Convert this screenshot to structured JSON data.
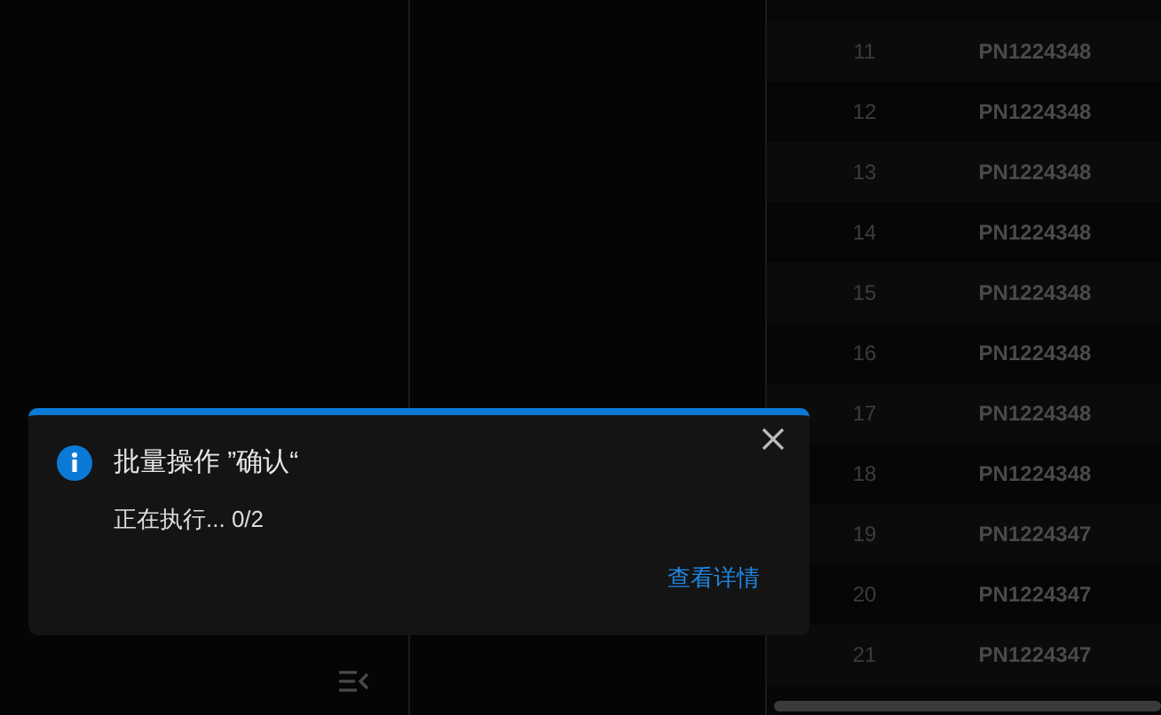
{
  "table": {
    "rows": [
      {
        "index": "11",
        "part_no": "PN1224348"
      },
      {
        "index": "12",
        "part_no": "PN1224348"
      },
      {
        "index": "13",
        "part_no": "PN1224348"
      },
      {
        "index": "14",
        "part_no": "PN1224348"
      },
      {
        "index": "15",
        "part_no": "PN1224348"
      },
      {
        "index": "16",
        "part_no": "PN1224348"
      },
      {
        "index": "17",
        "part_no": "PN1224348"
      },
      {
        "index": "18",
        "part_no": "PN1224348"
      },
      {
        "index": "19",
        "part_no": "PN1224347"
      },
      {
        "index": "20",
        "part_no": "PN1224347"
      },
      {
        "index": "21",
        "part_no": "PN1224347"
      }
    ]
  },
  "notification": {
    "title": "批量操作 ”确认“",
    "message": "正在执行... 0/2",
    "link": "查看详情"
  }
}
